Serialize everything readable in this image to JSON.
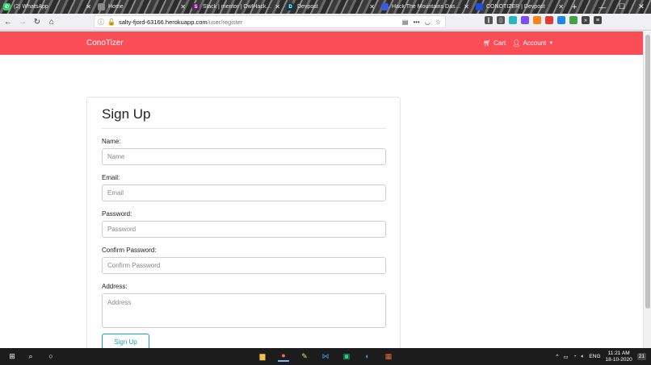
{
  "browser": {
    "tabs": [
      {
        "title": "(2) WhatsApp",
        "icon": "whatsapp-icon",
        "color": "#25d366",
        "active": false
      },
      {
        "title": "Home",
        "icon": "home-page-icon",
        "color": "#888888",
        "active": false
      },
      {
        "title": "Slack | mentor | OwlHacks 202",
        "icon": "slack-icon",
        "color": "#611f69",
        "active": false
      },
      {
        "title": "Devpost",
        "icon": "devpost-icon",
        "color": "#003e54",
        "active": false
      },
      {
        "title": "Hack The Mountains Dashbo",
        "icon": "htm-icon",
        "color": "#3b5bdb",
        "active": false
      },
      {
        "title": "CONOTIZER | Devpost",
        "icon": "devpost-icon",
        "color": "#1f4fd6",
        "active": true
      }
    ],
    "new_tab": "+",
    "url_host": "salty-fjord-63166.herokuapp.com",
    "url_path": "/user/register"
  },
  "navbar": {
    "brand": "ConoTizer",
    "cart_label": "Cart",
    "account_label": "Account"
  },
  "form": {
    "title": "Sign Up",
    "name_label": "Name:",
    "name_placeholder": "Name",
    "email_label": "Email:",
    "email_placeholder": "Email",
    "password_label": "Password:",
    "password_placeholder": "Password",
    "confirm_label": "Confirm Password:",
    "confirm_placeholder": "Confirm Password",
    "address_label": "Address:",
    "address_placeholder": "Address",
    "submit_label": "Sign Up"
  },
  "taskbar": {
    "language": "ENG",
    "time": "11:21 AM",
    "date": "18-10-2020",
    "notifications": "21"
  },
  "colors": {
    "navbar": "#fa4d55",
    "button_accent": "#17a2b8"
  }
}
